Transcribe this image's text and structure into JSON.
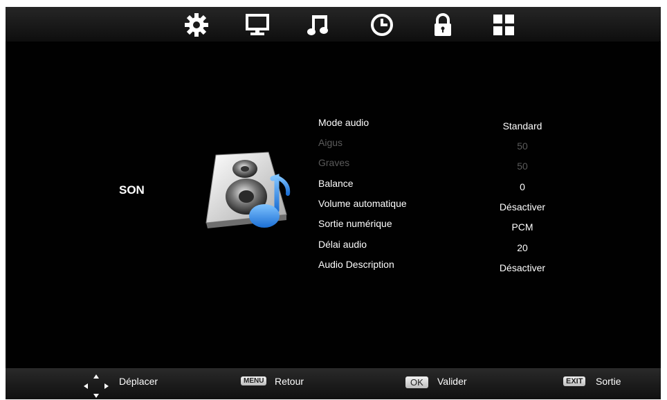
{
  "top_nav": {
    "items": [
      {
        "icon": "gear-icon"
      },
      {
        "icon": "monitor-icon"
      },
      {
        "icon": "music-note-icon"
      },
      {
        "icon": "clock-icon"
      },
      {
        "icon": "lock-icon"
      },
      {
        "icon": "grid-icon"
      }
    ]
  },
  "category": {
    "title": "SON",
    "icon": "speaker-music-icon"
  },
  "menu": {
    "items": [
      {
        "label": "Mode audio",
        "value": "Standard",
        "enabled": true
      },
      {
        "label": "Aigus",
        "value": "50",
        "enabled": false
      },
      {
        "label": "Graves",
        "value": "50",
        "enabled": false
      },
      {
        "label": "Balance",
        "value": "0",
        "enabled": true
      },
      {
        "label": "Volume automatique",
        "value": "Désactiver",
        "enabled": true
      },
      {
        "label": "Sortie numérique",
        "value": "PCM",
        "enabled": true
      },
      {
        "label": "Délai audio",
        "value": "20",
        "enabled": true
      },
      {
        "label": "Audio Description",
        "value": "Désactiver",
        "enabled": true
      }
    ]
  },
  "help_bar": {
    "move": {
      "label": "Déplacer"
    },
    "back": {
      "key": "MENU",
      "label": "Retour"
    },
    "ok": {
      "key": "OK",
      "label": "Valider"
    },
    "exit": {
      "key": "EXIT",
      "label": "Sortie"
    }
  },
  "colors": {
    "background": "#010101",
    "text": "#ffffff",
    "disabled_text": "#5b5b5b",
    "accent_blue": "#3a8ee6"
  }
}
